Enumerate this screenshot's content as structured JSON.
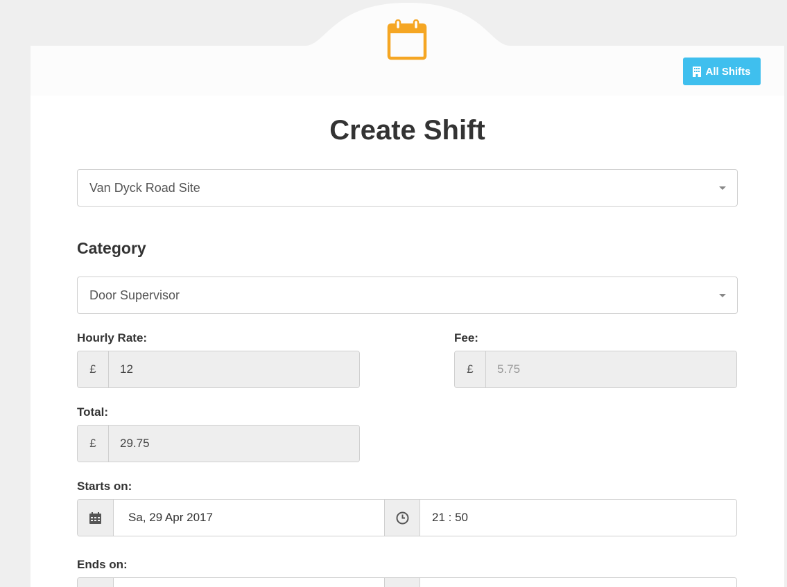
{
  "header": {
    "icon": "calendar-icon",
    "accent_color": "#f5a623",
    "all_shifts_label": "All Shifts",
    "all_shifts_icon": "building-icon",
    "button_color": "#3fbfee"
  },
  "page": {
    "title": "Create Shift"
  },
  "site_select": {
    "value": "Van Dyck Road Site"
  },
  "category": {
    "heading": "Category",
    "value": "Door Supervisor"
  },
  "rates": {
    "hourly_label": "Hourly Rate:",
    "hourly_currency": "£",
    "hourly_value": "12",
    "fee_label": "Fee:",
    "fee_currency": "£",
    "fee_value": "5.75",
    "total_label": "Total:",
    "total_currency": "£",
    "total_value": "29.75"
  },
  "starts": {
    "label": "Starts on:",
    "date": "Sa, 29 Apr 2017",
    "time": "21 : 50"
  },
  "ends": {
    "label": "Ends on:",
    "date": "",
    "time": ""
  }
}
